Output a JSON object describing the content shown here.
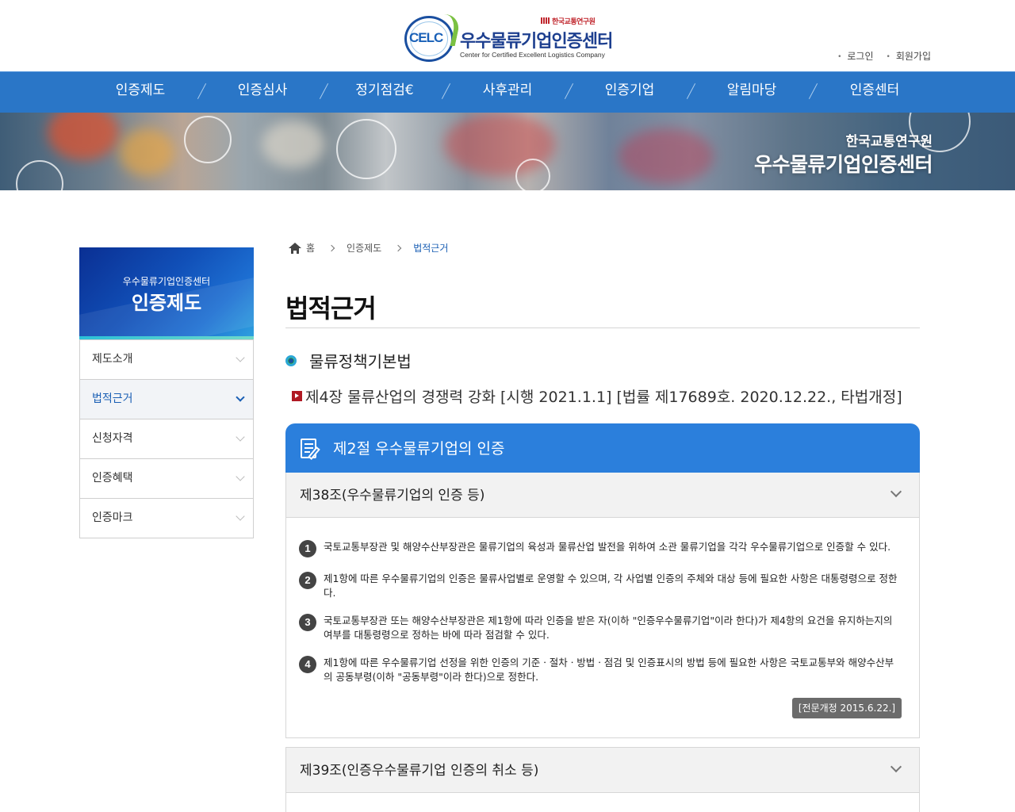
{
  "header": {
    "logo_mark": "CELC",
    "logo_institute": "한국교통연구원",
    "logo_title": "우수물류기업인증센터",
    "logo_subtitle": "Center for Certified Excellent Logistics Company",
    "util_links": [
      "로그인",
      "회원가입"
    ]
  },
  "gnb": {
    "items": [
      "인증제도",
      "인증심사",
      "정기점검€",
      "사후관리",
      "인증기업",
      "알림마당",
      "인증센터"
    ]
  },
  "visual": {
    "subtitle": "한국교통연구원",
    "title": "우수물류기업인증센터"
  },
  "sidebar": {
    "subtitle": "우수물류기업인증센터",
    "title": "인증제도",
    "items": [
      {
        "label": "제도소개",
        "active": false
      },
      {
        "label": "법적근거",
        "active": true
      },
      {
        "label": "신청자격",
        "active": false
      },
      {
        "label": "인증혜택",
        "active": false
      },
      {
        "label": "인증마크",
        "active": false
      }
    ]
  },
  "breadcrumb": {
    "home": "홈",
    "level1": "인증제도",
    "current": "법적근거"
  },
  "content": {
    "page_title": "법적근거",
    "law_name": "물류정책기본법",
    "chapter": "제4장 물류산업의 경쟁력 강화 [시행 2021.1.1] [법률 제17689호. 2020.12.22., 타법개정]",
    "section_title": "제2절 우수물류기업의 인증",
    "articles": [
      {
        "title": "제38조(우수물류기업의 인증 등)",
        "clauses": [
          {
            "num": "1",
            "text": "국토교통부장관 및 해양수산부장관은 물류기업의 육성과 물류산업 발전을 위하여 소관 물류기업을 각각 우수물류기업으로 인증할 수 있다."
          },
          {
            "num": "2",
            "text": "제1항에 따른 우수물류기업의 인증은 물류사업별로 운영할 수 있으며, 각 사업별 인증의 주체와 대상 등에 필요한 사항은 대통령령으로 정한다."
          },
          {
            "num": "3",
            "text": "국토교통부장관 또는 해양수산부장관은 제1항에 따라 인증을 받은 자(이하 \"인증우수물류기업\"이라 한다)가 제4항의 요건을 유지하는지의 여부를 대통령령으로 정하는 바에 따라 점검할 수 있다."
          },
          {
            "num": "4",
            "text": "제1항에 따른 우수물류기업 선정을 위한 인증의 기준ㆍ절차ㆍ방법ㆍ점검 및 인증표시의 방법 등에 필요한 사항은 국토교통부와 해양수산부의 공동부령(이하 \"공동부령\"이라 한다)으로 정한다."
          }
        ],
        "amendment": "[전문개정 2015.6.22.]"
      },
      {
        "title": "제39조(인증우수물류기업 인증의 취소 등)"
      }
    ]
  },
  "colors": {
    "gnb_blue": "#2a76c7",
    "section_blue": "#2b7fdc",
    "active_text": "#1a5fb4",
    "chapter_red": "#b01a24"
  }
}
